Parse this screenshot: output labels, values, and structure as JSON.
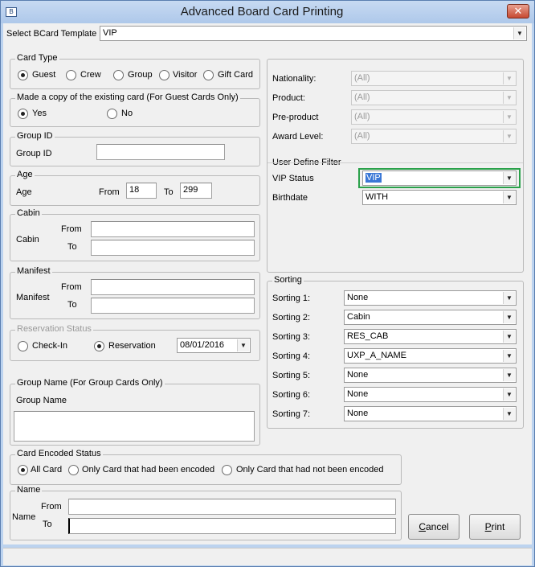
{
  "window": {
    "title": "Advanced Board Card Printing",
    "close_glyph": "✕",
    "app_icon": "app-icon",
    "app_icon_glyph": "B"
  },
  "template": {
    "label": "Select BCard Template",
    "value": "VIP"
  },
  "card_type": {
    "title": "Card Type",
    "options": [
      "Guest",
      "Crew",
      "Group",
      "Visitor",
      "Gift Card"
    ],
    "selected": "Guest"
  },
  "copy_card": {
    "title": "Made a copy of the existing card (For Guest Cards Only)",
    "yes": "Yes",
    "no": "No",
    "selected": "Yes"
  },
  "group_id": {
    "title": "Group ID",
    "label": "Group ID",
    "value": ""
  },
  "age": {
    "title": "Age",
    "label": "Age",
    "from_label": "From",
    "from_value": "18",
    "to_label": "To",
    "to_value": "299"
  },
  "cabin": {
    "title": "Cabin",
    "label": "Cabin",
    "from_label": "From",
    "to_label": "To",
    "from_value": "",
    "to_value": ""
  },
  "manifest": {
    "title": "Manifest",
    "label": "Manifest",
    "from_label": "From",
    "to_label": "To",
    "from_value": "",
    "to_value": ""
  },
  "reservation_status": {
    "title": "Reservation Status",
    "checkin": "Check-In",
    "reservation": "Reservation",
    "selected": "Reservation",
    "date": "08/01/2016"
  },
  "group_name": {
    "title": "Group Name (For Group Cards Only)",
    "label": "Group Name",
    "value": ""
  },
  "encoded_status": {
    "title": "Card Encoded Status",
    "options": [
      "All Card",
      "Only Card that had been encoded",
      "Only Card that had not been encoded"
    ],
    "selected": "All Card"
  },
  "name": {
    "title": "Name",
    "label": "Name",
    "from_label": "From",
    "to_label": "To",
    "from_value": "",
    "to_value": ""
  },
  "filters": {
    "nationality": {
      "label": "Nationality:",
      "value": "(All)"
    },
    "product": {
      "label": "Product:",
      "value": "(All)"
    },
    "pre_product": {
      "label": "Pre-product",
      "value": "(All)"
    },
    "award_level": {
      "label": "Award Level:",
      "value": "(All)"
    }
  },
  "user_define": {
    "title": "User Define Filter",
    "vip_label": "VIP Status",
    "vip_value": "VIP",
    "birthdate_label": "Birthdate",
    "birthdate_value": "WITH"
  },
  "sorting": {
    "title": "Sorting",
    "items": [
      {
        "label": "Sorting 1:",
        "value": "None"
      },
      {
        "label": "Sorting 2:",
        "value": "Cabin"
      },
      {
        "label": "Sorting 3:",
        "value": "RES_CAB"
      },
      {
        "label": "Sorting 4:",
        "value": "UXP_A_NAME"
      },
      {
        "label": "Sorting 5:",
        "value": "None"
      },
      {
        "label": "Sorting 6:",
        "value": "None"
      },
      {
        "label": "Sorting 7:",
        "value": "None"
      }
    ]
  },
  "buttons": {
    "cancel": "Cancel",
    "print": "Print"
  },
  "icons": {
    "dropdown": "▼"
  },
  "colors": {
    "highlight": "#2aa14a",
    "selection": "#3a77d6"
  }
}
